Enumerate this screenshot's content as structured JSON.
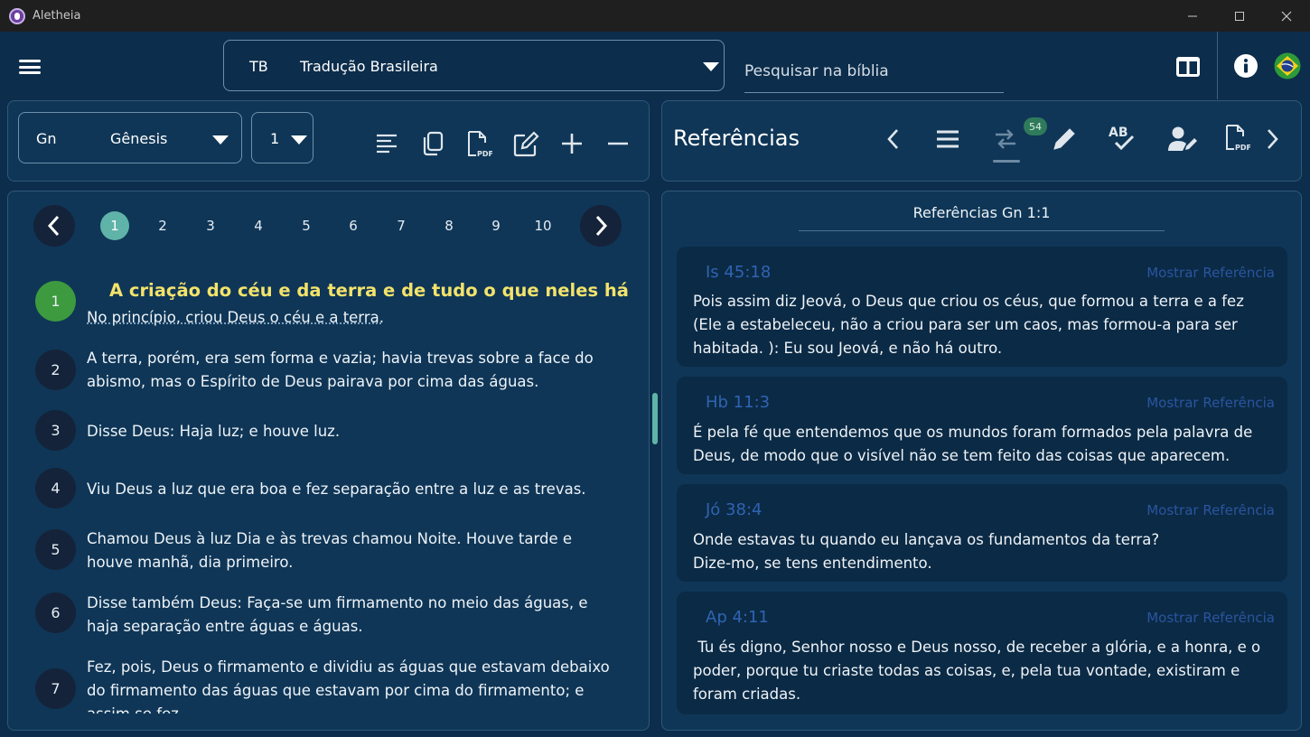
{
  "window": {
    "title": "Aletheia"
  },
  "header": {
    "version_abbr": "TB",
    "version_name": "Tradução Brasileira",
    "search_placeholder": "Pesquisar na bíblia"
  },
  "book_selector": {
    "abbr": "Gn",
    "name": "Gênesis",
    "chapter": "1"
  },
  "chapters": {
    "active": "1",
    "items": [
      "2",
      "3",
      "4",
      "5",
      "6",
      "7",
      "8",
      "9",
      "10"
    ]
  },
  "section_title": "A criação do céu e da terra e de tudo o que neles há",
  "verses": [
    {
      "num": "1",
      "text": "No princípio, criou Deus o céu e a terra."
    },
    {
      "num": "2",
      "text": "A terra, porém, era sem forma e vazia; havia trevas sobre a face do abismo, mas o Espírito de Deus pairava por cima das águas."
    },
    {
      "num": "3",
      "text": "Disse Deus: Haja luz; e houve luz."
    },
    {
      "num": "4",
      "text": "Viu Deus a luz que era boa e fez separação entre a luz e as trevas."
    },
    {
      "num": "5",
      "text": "Chamou Deus à luz Dia e às trevas chamou Noite. Houve tarde e houve manhã, dia primeiro."
    },
    {
      "num": "6",
      "text": "Disse também Deus: Faça-se um firmamento no meio das águas, e haja separação entre águas e águas."
    },
    {
      "num": "7",
      "text": "Fez, pois, Deus o firmamento e dividiu as águas que estavam debaixo do firmamento das águas que estavam por cima do firmamento; e assim se fez."
    }
  ],
  "references_panel": {
    "title": "Referências",
    "badge_count": "54",
    "subtitle": "Referências Gn 1:1",
    "show_label": "Mostrar Referência",
    "cards": [
      {
        "cite": "Is 45:18",
        "text": "Pois assim diz Jeová, o Deus que criou os céus, que formou a terra e a fez (Ele a estabeleceu, não a criou para ser um caos, mas formou-a para ser habitada. ): Eu sou Jeová, e não há outro."
      },
      {
        "cite": "Hb 11:3",
        "text": "É pela fé que entendemos que os mundos foram formados pela palavra de Deus, de modo que o visível não se tem feito das coisas que aparecem."
      },
      {
        "cite": "Jó 38:4",
        "text": "Onde estavas tu quando eu lançava os fundamentos da terra? Dize-mo, se tens entendimento."
      },
      {
        "cite": "Ap 4:11",
        "text": " Tu és digno, Senhor nosso e Deus nosso, de receber a glória, e a honra, e o poder, porque tu criaste todas as coisas, e, pela tua vontade, existiram e foram criadas."
      }
    ]
  },
  "colors": {
    "background": "#0c2d4b",
    "panel": "#0f3657",
    "accent_teal": "#5fb3a8",
    "active_verse": "#3d9a3e",
    "section_title": "#f3e36b",
    "reference_link": "#2f64b3"
  }
}
